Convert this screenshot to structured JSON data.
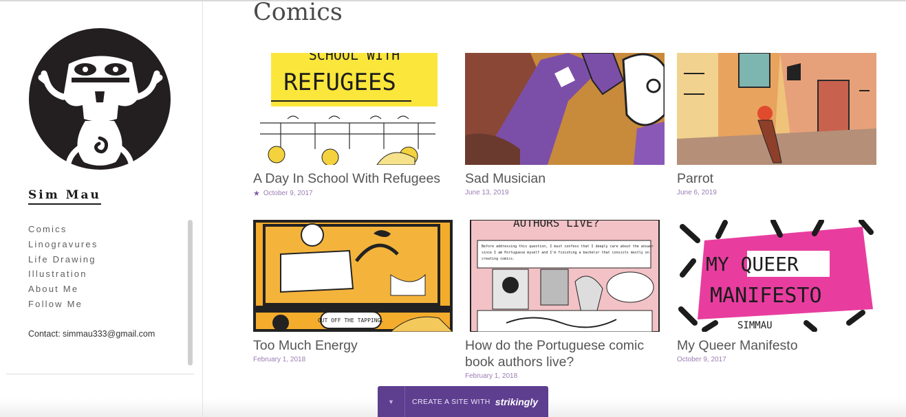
{
  "site": {
    "name": "Sim Mau"
  },
  "nav": [
    {
      "label": "Comics"
    },
    {
      "label": "Linogravures"
    },
    {
      "label": "Life Drawing"
    },
    {
      "label": "Illustration"
    },
    {
      "label": "About Me"
    },
    {
      "label": "Follow Me"
    }
  ],
  "contact": "Contact: simmau333@gmail.com",
  "main": {
    "title": "Comics"
  },
  "posts": [
    {
      "title": "A Day In School With Refugees",
      "date": "October 9, 2017",
      "starred": true
    },
    {
      "title": "Sad Musician",
      "date": "June 13, 2019"
    },
    {
      "title": "Parrot",
      "date": "June 6, 2019"
    },
    {
      "title": "Too Much Energy",
      "date": "February 1, 2018"
    },
    {
      "title": "How do the Portuguese comic book authors live?",
      "date": "February 1, 2018"
    },
    {
      "title": "My Queer Manifesto",
      "date": "October 9, 2017"
    }
  ],
  "thumb_text": {
    "refugees_top": "SCHOOL WITH",
    "refugees": "REFUGEES",
    "energy": "CUT OFF THE TAPPING.",
    "authors": "AUTHORS LIVE?",
    "authors_p1": "Before addressing this question, I must confess that I deeply care about the answer",
    "authors_p2": "since I am Portuguese myself and I'm finishing a bachelor that consists mostly on",
    "authors_p3": "creating comics.",
    "queer1": "MY QUEER",
    "queer2": "MANIFESTO",
    "queer_author": "SIMMAU"
  },
  "banner": {
    "text": "CREATE A SITE WITH",
    "brand": "strikingly"
  },
  "colors": {
    "accent": "#5d3e8f",
    "date": "#9b7bb3",
    "sidebar_border": "#e2e2e2"
  }
}
